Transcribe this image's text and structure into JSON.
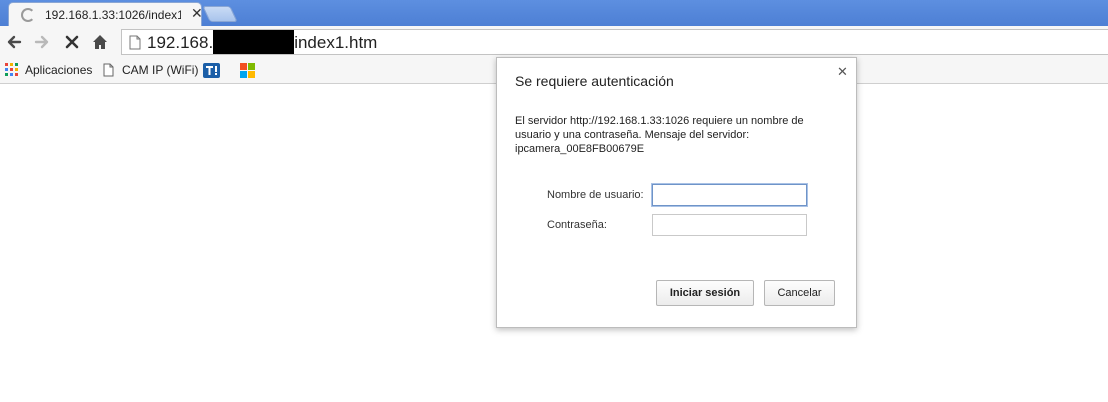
{
  "tab": {
    "title": "192.168.1.33:1026/index1.htm",
    "close_glyph": "✕"
  },
  "address_bar": {
    "url_prefix": "192.168.",
    "url_suffix": "index1.htm"
  },
  "bookmarks": {
    "items": [
      {
        "label": "Aplicaciones",
        "icon": "apps-grid-icon"
      },
      {
        "label": "CAM IP (WiFi)",
        "icon": "page-icon"
      },
      {
        "label": "",
        "icon": "t-logo-icon"
      },
      {
        "label": "",
        "icon": "windows-logo-icon"
      }
    ]
  },
  "dialog": {
    "title": "Se requiere autenticación",
    "message": "El servidor http://192.168.1.33:1026 requiere un nombre de usuario y una contraseña. Mensaje del servidor: ipcamera_00E8FB00679E",
    "username_label": "Nombre de usuario:",
    "username_value": "",
    "password_label": "Contraseña:",
    "password_value": "",
    "login_button": "Iniciar sesión",
    "cancel_button": "Cancelar",
    "close_glyph": "✕"
  },
  "colors": {
    "tabstrip": "#4d7fd4",
    "toolbar": "#f6f6f6",
    "focus_border": "#6f94c8"
  }
}
